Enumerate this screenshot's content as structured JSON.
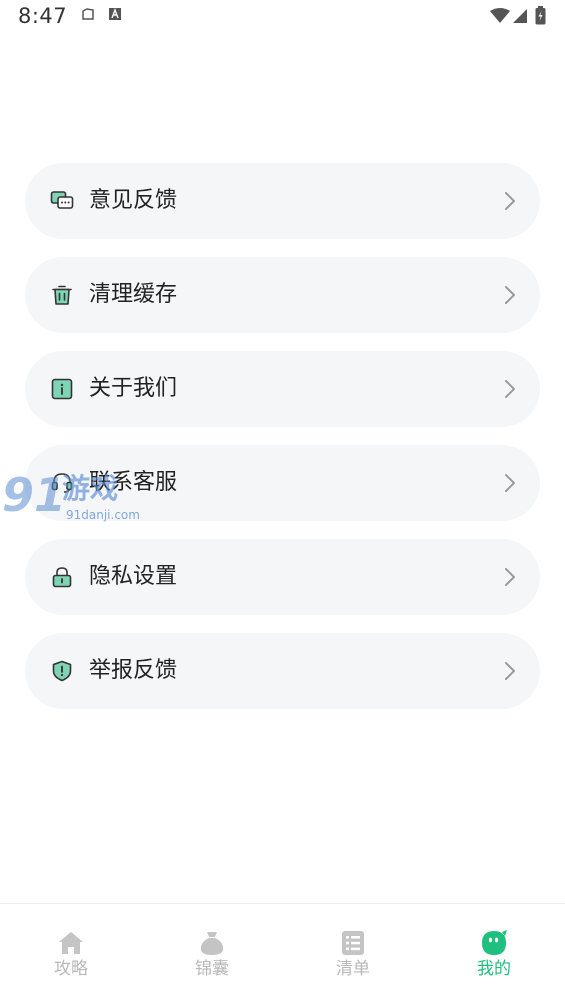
{
  "status_bar": {
    "time": "8:47"
  },
  "menu": {
    "items": [
      {
        "label": "意见反馈",
        "icon": "feedback-icon"
      },
      {
        "label": "清理缓存",
        "icon": "trash-icon"
      },
      {
        "label": "关于我们",
        "icon": "info-icon"
      },
      {
        "label": "联系客服",
        "icon": "headset-icon"
      },
      {
        "label": "隐私设置",
        "icon": "lock-icon"
      },
      {
        "label": "举报反馈",
        "icon": "shield-alert-icon"
      }
    ]
  },
  "watermark": {
    "logo": "91",
    "brand": "游戏",
    "domain": "91danji.com"
  },
  "bottom_nav": {
    "items": [
      {
        "label": "攻略",
        "icon": "home-icon",
        "active": false
      },
      {
        "label": "锦囊",
        "icon": "bag-icon",
        "active": false
      },
      {
        "label": "清单",
        "icon": "list-icon",
        "active": false
      },
      {
        "label": "我的",
        "icon": "profile-icon",
        "active": true
      }
    ]
  },
  "colors": {
    "accent": "#1fbf7f",
    "icon_fill": "#7ed4b4",
    "icon_stroke": "#333333",
    "item_bg": "#f5f6f8",
    "nav_inactive": "#b8b8b8"
  }
}
